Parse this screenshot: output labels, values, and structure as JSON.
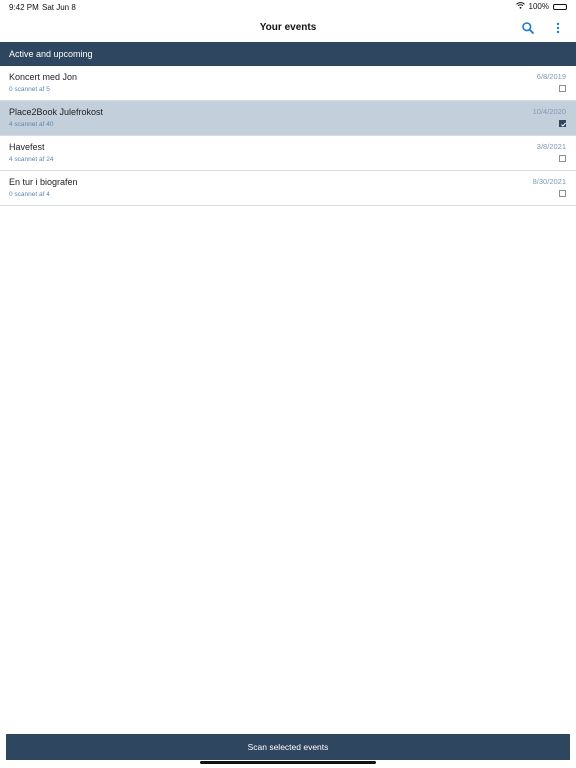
{
  "status_bar": {
    "time": "9:42 PM",
    "date": "Sat Jun 8",
    "battery": "100%",
    "icons": [
      "wifi-icon",
      "battery-icon"
    ]
  },
  "nav": {
    "title": "Your events",
    "icons": [
      "search-icon",
      "more-vertical-icon"
    ]
  },
  "section": {
    "title": "Active and upcoming"
  },
  "events": [
    {
      "name": "Koncert med Jon",
      "subtitle": "0 scannet af 5",
      "date": "6/8/2019",
      "checked": false
    },
    {
      "name": "Place2Book Julefrokost",
      "subtitle": "4 scannet af 40",
      "date": "10/4/2020",
      "checked": true
    },
    {
      "name": "Havefest",
      "subtitle": "4 scannet af 24",
      "date": "3/8/2021",
      "checked": false
    },
    {
      "name": "En tur i biografen",
      "subtitle": "0 scannet af 4",
      "date": "8/30/2021",
      "checked": false
    }
  ],
  "footer": {
    "scan_label": "Scan selected events"
  },
  "colors": {
    "primary": "#2f4660",
    "accent": "#1a7ad9",
    "selected_row": "#c4cfdc"
  }
}
